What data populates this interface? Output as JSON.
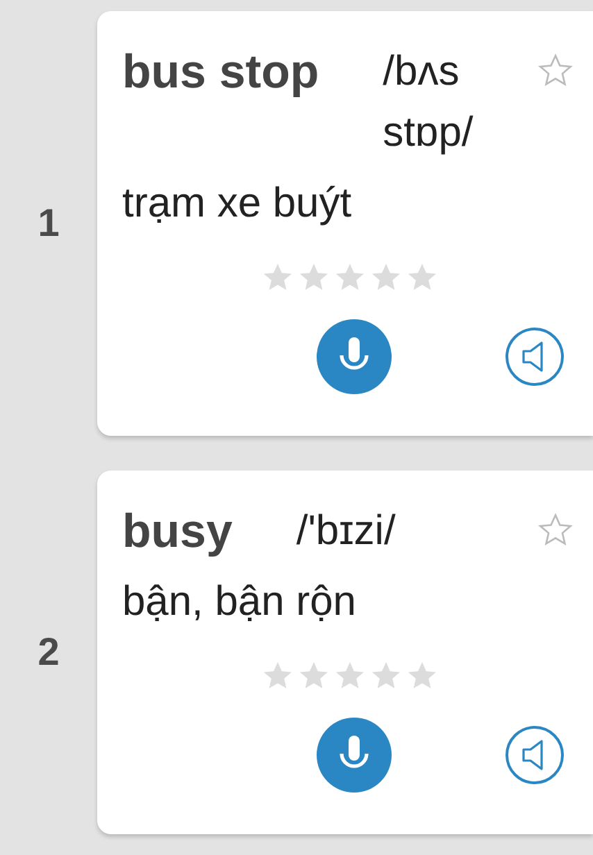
{
  "words": [
    {
      "number": "1",
      "word": "bus stop",
      "phonetic": "/bʌs stɒp/",
      "favorite": false,
      "meaning": "trạm xe buýt",
      "stars": 0
    },
    {
      "number": "2",
      "word": "busy",
      "phonetic": "/'bɪzi/",
      "favorite": false,
      "meaning": "bận, bận rộn",
      "stars": 0
    }
  ]
}
